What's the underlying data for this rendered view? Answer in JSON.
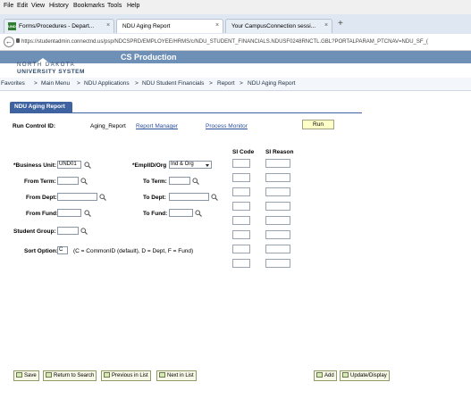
{
  "browser": {
    "menu": [
      "File",
      "Edit",
      "View",
      "History",
      "Bookmarks",
      "Tools",
      "Help"
    ],
    "tabs": [
      {
        "label": "Forms/Procedures - Depart...",
        "favicon": "UND"
      },
      {
        "label": "NDU Aging Report"
      },
      {
        "label": "Your CampusConnection sessi..."
      }
    ],
    "new_tab": "+",
    "close": "×",
    "url": "https://studentadmin.connectnd.us/psp/NDCSPRD/EMPLOYEE/HRMS/c/NDU_STUDENT_FINANCIALS.NDUSF0248RNCTL.GBL?PORTALPARAM_PTCNAV=NDU_SF_("
  },
  "header": {
    "environment": "CS Production",
    "logo_line1": "NORTH DAKOTA",
    "logo_line2": "UNIVERSITY SYSTEM"
  },
  "breadcrumb": [
    "Favorites",
    "Main Menu",
    "NDU Applications",
    "NDU Student Financials",
    "Report",
    "NDU Aging Report"
  ],
  "breadcrumb_sep": ">",
  "page_tab": "NDU Aging Report",
  "run_control": {
    "label": "Run Control ID:",
    "value": "Aging_Report",
    "report_manager": "Report Manager",
    "process_monitor": "Process Monitor",
    "run": "Run"
  },
  "si_headers": {
    "code": "SI Code",
    "reason": "SI Reason"
  },
  "form": {
    "business_unit_label": "*Business Unit:",
    "business_unit_value": "UND01",
    "emplid_org_label": "*EmplID/Org",
    "emplid_org_value": "Ind & Org",
    "from_term_label": "From Term:",
    "to_term_label": "To Term:",
    "from_dept_label": "From Dept:",
    "to_dept_label": "To Dept:",
    "from_fund_label": "From Fund:",
    "to_fund_label": "To Fund:",
    "student_group_label": "Student Group:",
    "sort_option_label": "Sort Option:",
    "sort_option_value": "C",
    "sort_option_help": "(C = CommonID (default), D = Dept, F = Fund)"
  },
  "footer": {
    "save": "Save",
    "return_to_search": "Return to Search",
    "previous_in_list": "Previous in List",
    "next_in_list": "Next in List",
    "add": "Add",
    "update_display": "Update/Display"
  }
}
